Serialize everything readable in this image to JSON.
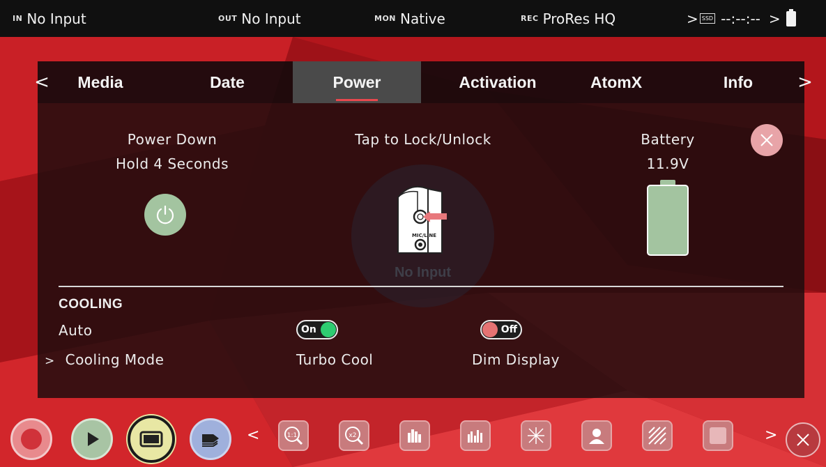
{
  "status_bar": {
    "in_tag": "IN",
    "in_value": "No Input",
    "out_tag": "OUT",
    "out_value": "No Input",
    "mon_tag": "MON",
    "mon_value": "Native",
    "rec_tag": "REC",
    "rec_value": "ProRes HQ",
    "media_prefix": ">",
    "media_label": "SSD",
    "timecode": "--:--:--",
    "more_arrow": ">"
  },
  "tabs": {
    "prev_arrow": "<",
    "next_arrow": ">",
    "items": [
      {
        "label": "Media"
      },
      {
        "label": "Date"
      },
      {
        "label": "Power",
        "active": true
      },
      {
        "label": "Activation"
      },
      {
        "label": "AtomX"
      },
      {
        "label": "Info"
      }
    ]
  },
  "power": {
    "power_down_title": "Power Down",
    "power_down_hint": "Hold 4 Seconds",
    "lock_title": "Tap to Lock/Unlock",
    "lock_overlay_text": "No Input",
    "lock_port_label": "MIC/LINE",
    "battery_title": "Battery",
    "battery_value": "11.9V"
  },
  "cooling": {
    "heading": "COOLING",
    "mode_value": "Auto",
    "mode_label": "Cooling Mode",
    "mode_arrow": ">",
    "turbo_label": "Turbo Cool",
    "turbo_state": "On",
    "dim_label": "Dim Display",
    "dim_state": "Off"
  },
  "toolbar": {
    "prev_arrow": "<",
    "next_arrow": ">",
    "buttons": [
      {
        "icon": "record-icon"
      },
      {
        "icon": "play-icon"
      },
      {
        "icon": "monitor-icon"
      },
      {
        "icon": "tag-icon"
      }
    ],
    "tools": [
      {
        "icon": "zoom-1to1-icon",
        "text": "1:1"
      },
      {
        "icon": "zoom-x2-icon",
        "text": "x2"
      },
      {
        "icon": "waveform-icon"
      },
      {
        "icon": "rgb-parade-icon"
      },
      {
        "icon": "vectorscope-icon"
      },
      {
        "icon": "false-color-icon"
      },
      {
        "icon": "zebra-icon"
      },
      {
        "icon": "blank-icon"
      }
    ]
  },
  "colors": {
    "accent_red": "#e8484e",
    "power_green": "#a3c4a0",
    "toggle_on": "#2ecc71",
    "toggle_off": "#e57373"
  }
}
